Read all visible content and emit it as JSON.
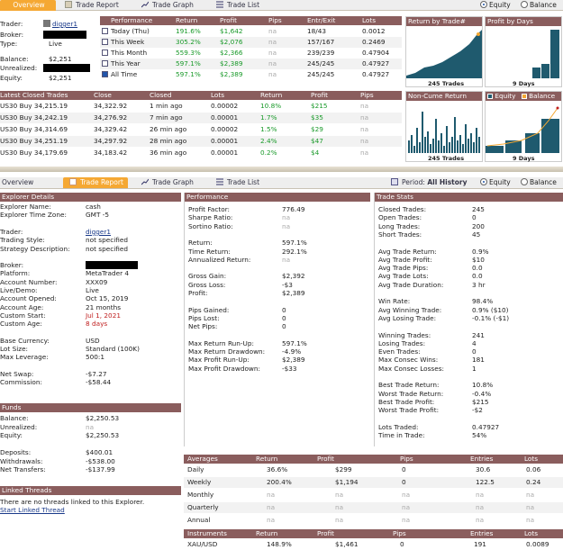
{
  "top_tabs": [
    "Overview",
    "Trade Report",
    "Trade Graph",
    "Trade List"
  ],
  "radio": {
    "equity": "Equity",
    "balance": "Balance"
  },
  "account": {
    "rows": [
      [
        "Trader:",
        "digger1"
      ],
      [
        "Broker:",
        ""
      ],
      [
        "Type:",
        "Live"
      ],
      [
        "Balance:",
        "$2,251"
      ],
      [
        "Unrealized:",
        ""
      ],
      [
        "Equity:",
        "$2,251"
      ]
    ]
  },
  "perf": {
    "headers": [
      "Performance",
      "Return",
      "Profit",
      "Pips",
      "Entr/Exit",
      "Lots"
    ],
    "rows": [
      [
        "Today (Thu)",
        "191.6%",
        "$1,642",
        "na",
        "18/43",
        "0.0012"
      ],
      [
        "This Week",
        "305.2%",
        "$2,076",
        "na",
        "157/167",
        "0.2469"
      ],
      [
        "This Month",
        "559.3%",
        "$2,366",
        "na",
        "239/239",
        "0.47904"
      ],
      [
        "This Year",
        "597.1%",
        "$2,389",
        "na",
        "245/245",
        "0.47927"
      ],
      [
        "All Time",
        "597.1%",
        "$2,389",
        "na",
        "245/245",
        "0.47927"
      ]
    ]
  },
  "charts": {
    "by_trade": "Return by Trade#",
    "by_trade_x": "245 Trades",
    "by_days": "Profit by Days",
    "by_days_x": "9 Days",
    "noncume": "Non-Cume Return",
    "noncume_x": "245 Trades",
    "eqbal_equity": "Equity",
    "eqbal_balance": "Balance",
    "eqbal_x": "9 Days"
  },
  "closed": {
    "headers": [
      "Latest Closed Trades",
      "Close",
      "Closed",
      "Lots",
      "Return",
      "Profit",
      "Pips"
    ],
    "rows": [
      [
        "US30 Buy 34,215.19",
        "34,322.92",
        "1 min ago",
        "0.00002",
        "10.8%",
        "$215",
        "na"
      ],
      [
        "US30 Buy 34,242.19",
        "34,276.92",
        "7 min ago",
        "0.00001",
        "1.7%",
        "$35",
        "na"
      ],
      [
        "US30 Buy 34,314.69",
        "34,329.42",
        "26 min ago",
        "0.00002",
        "1.5%",
        "$29",
        "na"
      ],
      [
        "US30 Buy 34,251.19",
        "34,297.92",
        "28 min ago",
        "0.00001",
        "2.4%",
        "$47",
        "na"
      ],
      [
        "US30 Buy 34,179.69",
        "34,183.42",
        "36 min ago",
        "0.00001",
        "0.2%",
        "$4",
        "na"
      ]
    ]
  },
  "period": {
    "label": "Period:",
    "value": "All History"
  },
  "explorer": {
    "title": "Explorer Details",
    "rows": [
      [
        "Explorer Name:",
        "cash"
      ],
      [
        "Explorer Time Zone:",
        "GMT -5"
      ],
      [
        "",
        ""
      ],
      [
        "Trader:",
        "digger1"
      ],
      [
        "Trading Style:",
        "not specified"
      ],
      [
        "Strategy Description:",
        "not specified"
      ],
      [
        "",
        ""
      ],
      [
        "Broker:",
        ""
      ],
      [
        "Platform:",
        "MetaTrader 4"
      ],
      [
        "Account Number:",
        "XXX09"
      ],
      [
        "Live/Demo:",
        "Live"
      ],
      [
        "Account Opened:",
        "Oct 15, 2019"
      ],
      [
        "Account Age:",
        "21 months"
      ],
      [
        "Custom Start:",
        "Jul 1, 2021"
      ],
      [
        "Custom Age:",
        "8 days"
      ],
      [
        "",
        ""
      ],
      [
        "Base Currency:",
        "USD"
      ],
      [
        "Lot Size:",
        "Standard (100K)"
      ],
      [
        "Max Leverage:",
        "500:1"
      ],
      [
        "",
        ""
      ],
      [
        "Net Swap:",
        "-$7.27"
      ],
      [
        "Commission:",
        "-$58.44"
      ]
    ]
  },
  "funds": {
    "title": "Funds",
    "rows": [
      [
        "Balance:",
        "$2,250.53"
      ],
      [
        "Unrealized:",
        "na"
      ],
      [
        "Equity:",
        "$2,250.53"
      ],
      [
        "",
        ""
      ],
      [
        "Deposits:",
        "$400.01"
      ],
      [
        "Withdrawals:",
        "-$538.00"
      ],
      [
        "Net Transfers:",
        "-$137.99"
      ]
    ]
  },
  "linked": {
    "title": "Linked Threads",
    "text": "There are no threads linked to this Explorer.",
    "link": "Start Linked Thread"
  },
  "performance": {
    "title": "Performance",
    "rows": [
      [
        "Profit Factor:",
        "776.49"
      ],
      [
        "Sharpe Ratio:",
        "na"
      ],
      [
        "Sortino Ratio:",
        "na"
      ],
      [
        "",
        ""
      ],
      [
        "Return:",
        "597.1%"
      ],
      [
        "Time Return:",
        "292.1%"
      ],
      [
        "Annualized Return:",
        "na"
      ],
      [
        "",
        ""
      ],
      [
        "Gross Gain:",
        "$2,392"
      ],
      [
        "Gross Loss:",
        "-$3"
      ],
      [
        "Profit:",
        "$2,389"
      ],
      [
        "",
        ""
      ],
      [
        "Pips Gained:",
        "0"
      ],
      [
        "Pips Lost:",
        "0"
      ],
      [
        "Net Pips:",
        "0"
      ],
      [
        "",
        ""
      ],
      [
        "Max Return Run-Up:",
        "597.1%"
      ],
      [
        "Max Return Drawdown:",
        "-4.9%"
      ],
      [
        "Max Profit Run-Up:",
        "$2,389"
      ],
      [
        "Max Profit Drawdown:",
        "-$33"
      ]
    ]
  },
  "stats": {
    "title": "Trade Stats",
    "rows": [
      [
        "Closed Trades:",
        "245"
      ],
      [
        "Open Trades:",
        "0"
      ],
      [
        "Long Trades:",
        "200"
      ],
      [
        "Short Trades:",
        "45"
      ],
      [
        "",
        ""
      ],
      [
        "Avg Trade Return:",
        "0.9%"
      ],
      [
        "Avg Trade Profit:",
        "$10"
      ],
      [
        "Avg Trade Pips:",
        "0.0"
      ],
      [
        "Avg Trade Lots:",
        "0.0"
      ],
      [
        "Avg Trade Duration:",
        "3 hr"
      ],
      [
        "",
        ""
      ],
      [
        "Win Rate:",
        "98.4%"
      ],
      [
        "Avg Winning Trade:",
        "0.9% ($10)"
      ],
      [
        "Avg Losing Trade:",
        "-0.1% (-$1)"
      ],
      [
        "",
        ""
      ],
      [
        "Winning Trades:",
        "241"
      ],
      [
        "Losing Trades:",
        "4"
      ],
      [
        "Even Trades:",
        "0"
      ],
      [
        "Max Consec Wins:",
        "181"
      ],
      [
        "Max Consec Losses:",
        "1"
      ],
      [
        "",
        ""
      ],
      [
        "Best Trade Return:",
        "10.8%"
      ],
      [
        "Worst Trade Return:",
        "-0.4%"
      ],
      [
        "Best Trade Profit:",
        "$215"
      ],
      [
        "Worst Trade Profit:",
        "-$2"
      ],
      [
        "",
        ""
      ],
      [
        "Lots Traded:",
        "0.47927"
      ],
      [
        "Time in Trade:",
        "54%"
      ]
    ]
  },
  "averages": {
    "headers": [
      "Averages",
      "Return",
      "Profit",
      "Pips",
      "Entries",
      "Lots"
    ],
    "rows": [
      [
        "Daily",
        "36.6%",
        "$299",
        "0",
        "30.6",
        "0.06"
      ],
      [
        "Weekly",
        "200.4%",
        "$1,194",
        "0",
        "122.5",
        "0.24"
      ],
      [
        "Monthly",
        "na",
        "na",
        "na",
        "na",
        "na"
      ],
      [
        "Quarterly",
        "na",
        "na",
        "na",
        "na",
        "na"
      ],
      [
        "Annual",
        "na",
        "na",
        "na",
        "na",
        "na"
      ]
    ]
  },
  "instruments": {
    "headers": [
      "Instruments",
      "Return",
      "Profit",
      "Pips",
      "Entries",
      "Lots"
    ],
    "rows": [
      [
        "XAU/USD",
        "148.9%",
        "$1,461",
        "0",
        "191",
        "0.0089"
      ]
    ]
  },
  "colors": {
    "header": "#8a5d5d",
    "active_tab": "#f5a833",
    "chart_fill": "#1f5a6e",
    "green": "#1a9a2a",
    "red": "#c02020"
  }
}
